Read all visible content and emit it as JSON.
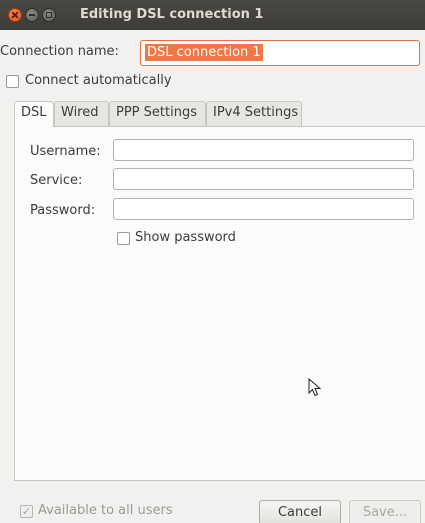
{
  "window": {
    "title": "Editing DSL connection 1"
  },
  "connection": {
    "name_label": "Connection name:",
    "name_value": "DSL connection 1"
  },
  "connect_automatically": {
    "label": "Connect automatically",
    "checked": false
  },
  "tabs": [
    {
      "label": "DSL",
      "active": true
    },
    {
      "label": "Wired",
      "active": false
    },
    {
      "label": "PPP Settings",
      "active": false
    },
    {
      "label": "IPv4 Settings",
      "active": false
    }
  ],
  "dsl_form": {
    "username_label": "Username:",
    "username_value": "",
    "service_label": "Service:",
    "service_value": "",
    "password_label": "Password:",
    "password_value": "",
    "show_password_label": "Show password",
    "show_password_checked": false
  },
  "footer": {
    "available_to_all_users_label": "Available to all users",
    "available_to_all_users_checked": true,
    "cancel_label": "Cancel",
    "save_label": "Save..."
  },
  "colors": {
    "titlebar": "#3c3b37",
    "selection": "#f07746",
    "close_button": "#e0531c"
  },
  "icons": [
    "close-icon",
    "minimize-icon",
    "maximize-icon",
    "mouse-pointer-icon",
    "checkmark-icon"
  ]
}
